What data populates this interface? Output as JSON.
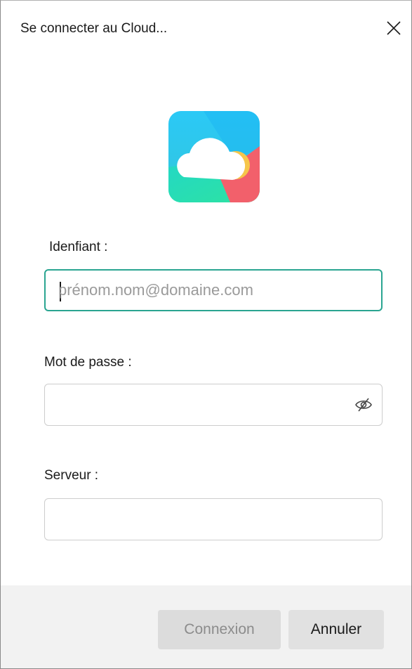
{
  "dialog": {
    "title": "Se connecter au Cloud...",
    "close_icon": "close-icon"
  },
  "logo": {
    "icon": "cloud-app-logo",
    "colors": {
      "top": "#31c4f3",
      "bottom": "#29dbb1",
      "corner": "#f25f6a",
      "sun": "#f5c84b",
      "cloud": "#ffffff"
    }
  },
  "form": {
    "username_label": "Idenfiant :",
    "username_placeholder": "prénom.nom@domaine.com",
    "username_value": "",
    "password_label": "Mot de passe :",
    "password_value": "",
    "password_toggle_icon": "eye-slash-icon",
    "server_label": "Serveur :",
    "server_value": ""
  },
  "footer": {
    "connect_label": "Connexion",
    "cancel_label": "Annuler"
  },
  "colors": {
    "focus_border": "#2aa591",
    "footer_bg": "#f2f2f2",
    "disabled_text": "#8c8c8c"
  }
}
